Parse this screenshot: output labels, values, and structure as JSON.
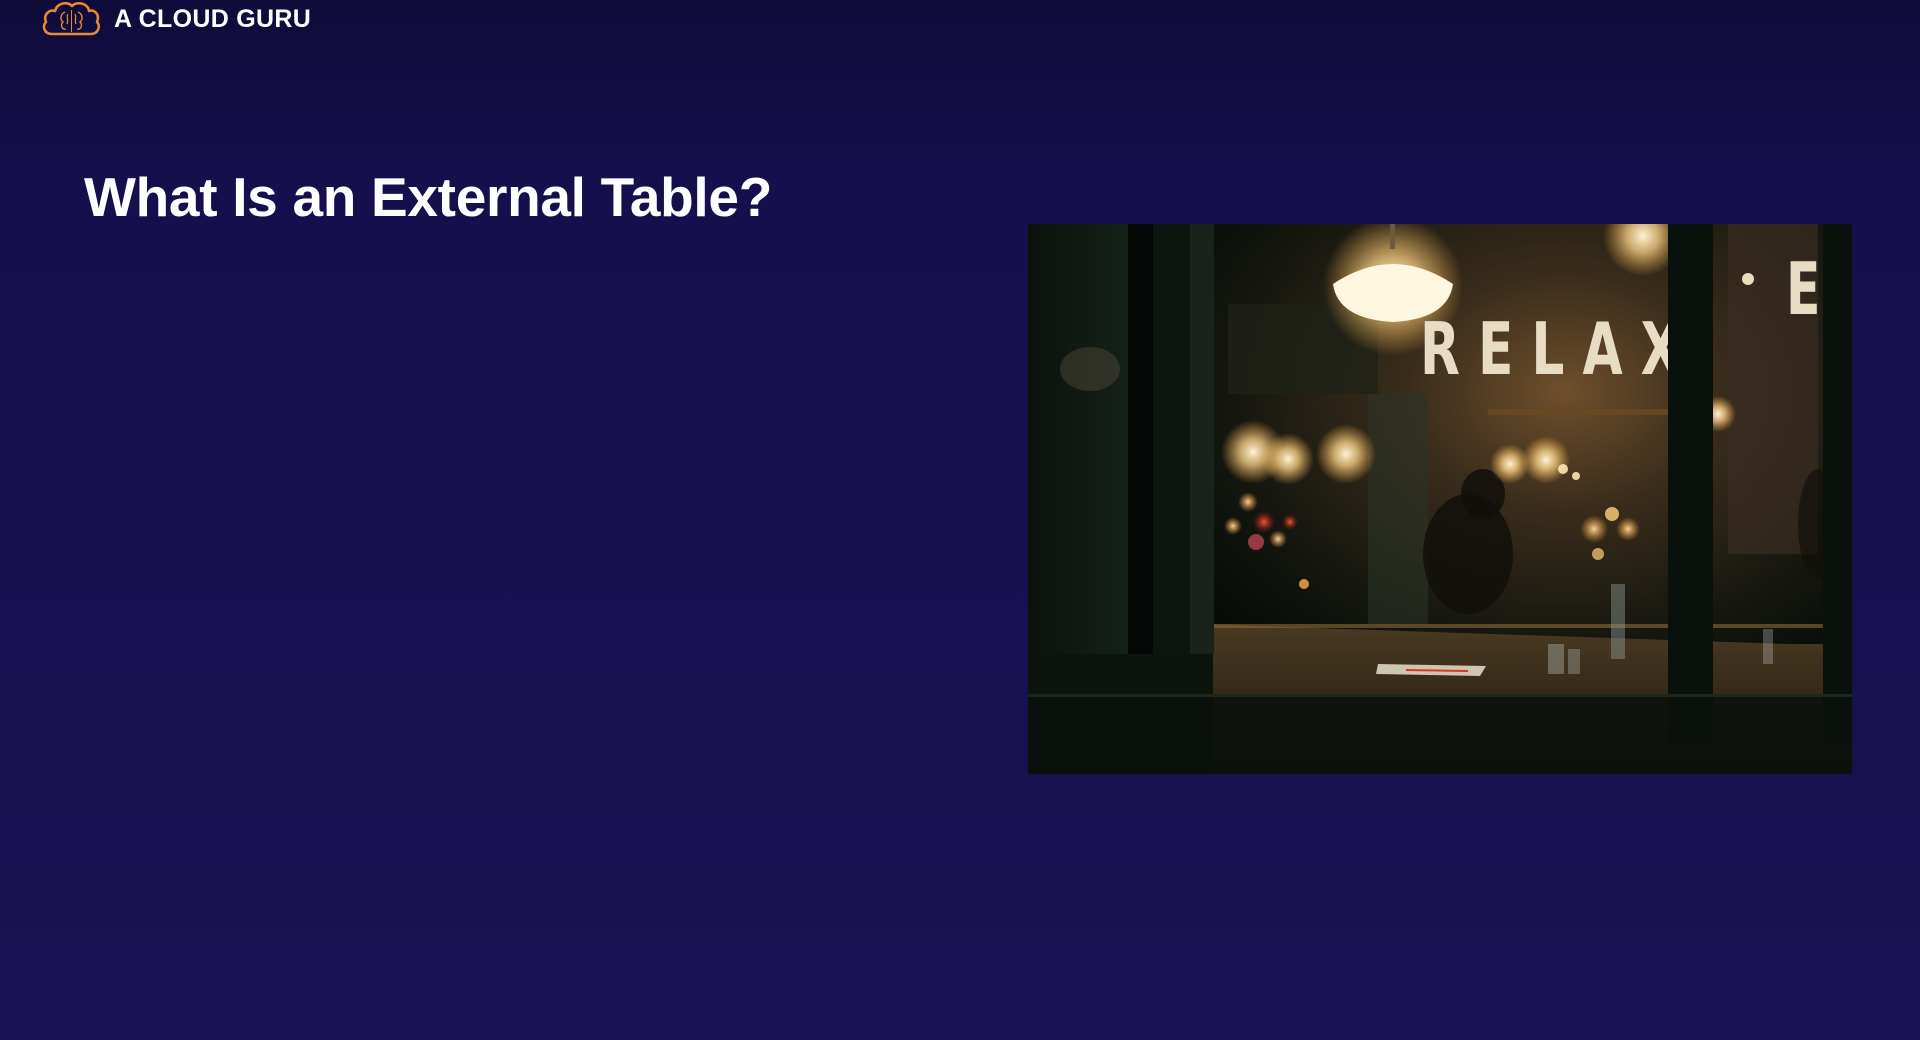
{
  "header": {
    "logo_icon": "cloud-brain-icon",
    "logo_text": "A CLOUD GURU",
    "brand_color": "#e9873a"
  },
  "slide": {
    "title": "What Is an External Table?",
    "image": {
      "subject": "bar-window-photo",
      "sign_text": "RELAX"
    }
  },
  "colors": {
    "background_top": "#0f0b3a",
    "background_bottom": "#1a1252",
    "text": "#ffffff"
  }
}
